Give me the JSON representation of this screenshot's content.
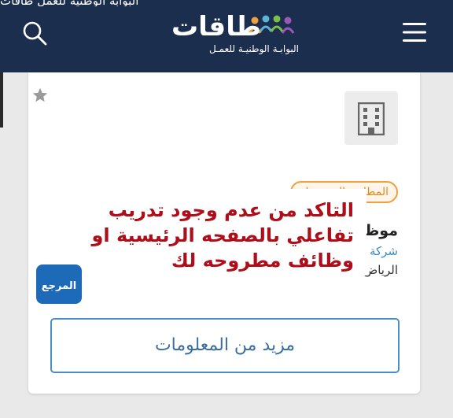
{
  "header": {
    "top_strip_text": "البوابة الوطنية للعمل طاقات",
    "logo_title": "طاقات",
    "logo_subtitle": "البوابـة الوطنيـة للعمـل",
    "bg_color": "#1c2e4d"
  },
  "job_card": {
    "badge": "المطابقة المتوسطة",
    "title": "موظ",
    "company": "شركة",
    "city": "الرياض",
    "more_button": "مزيد من المعلومات",
    "badge_color": "#f0a03c"
  },
  "overlay": {
    "line1": "التاكد من عدم وجود تدريب",
    "line2": "تفاعلي بالصفحه الرئيسية او",
    "line3": "وظائف مطروحه لك",
    "text_color": "#b00d1a"
  },
  "watermark": {
    "text": "المرجع"
  },
  "icons": {
    "search": "search-icon",
    "menu": "menu-icon",
    "favorite": "star-icon",
    "company_logo": "building-icon"
  }
}
